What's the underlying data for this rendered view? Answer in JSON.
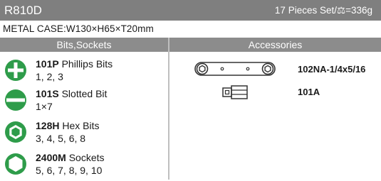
{
  "header": {
    "model": "R810D",
    "pieces": "17 Pieces Set/⚖=336g"
  },
  "case_dimensions": "METAL CASE:W130×H65×T20mm",
  "columns": {
    "left": "Bits,Sockets",
    "right": "Accessories"
  },
  "bits": [
    {
      "code": "101P",
      "name": " Phillips Bits",
      "sizes": "1, 2, 3",
      "icon": "phillips-icon"
    },
    {
      "code": "101S",
      "name": " Slotted Bit",
      "sizes": "1×7",
      "icon": "slotted-icon"
    },
    {
      "code": "128H",
      "name": " Hex Bits",
      "sizes": "3, 4, 5, 6, 8",
      "icon": "hex-icon"
    },
    {
      "code": "2400M",
      "name": " Sockets",
      "sizes": "5, 6, 7, 8, 9, 10",
      "icon": "socket-icon"
    }
  ],
  "accessories": [
    {
      "label": "102NA-1/4x5/16",
      "icon": "ratchet-wrench-icon"
    },
    {
      "label": "101A",
      "icon": "bit-adapter-icon"
    }
  ],
  "colors": {
    "accent_green": "#2e9c4a",
    "header_gray": "#7f7f7f",
    "column_header_gray": "#8c8c8c"
  }
}
